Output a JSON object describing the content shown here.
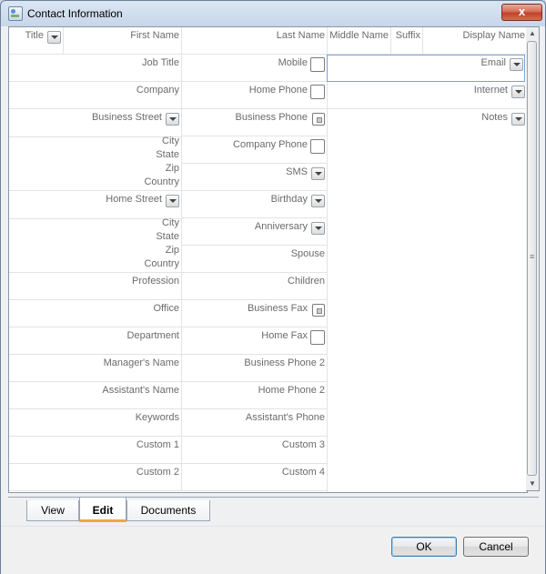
{
  "window": {
    "title": "Contact Information",
    "close_label": "x"
  },
  "header": {
    "title": "Title",
    "first_name": "First Name",
    "last_name": "Last Name",
    "middle_name": "Middle Name",
    "suffix": "Suffix",
    "display_name": "Display Name"
  },
  "col1": {
    "job_title": "Job Title",
    "company": "Company",
    "business_street": "Business Street",
    "business_city": "City",
    "business_state": "State",
    "business_zip": "Zip",
    "business_country": "Country",
    "home_street": "Home Street",
    "home_city": "City",
    "home_state": "State",
    "home_zip": "Zip",
    "home_country": "Country",
    "profession": "Profession",
    "office": "Office",
    "department": "Department",
    "managers_name": "Manager's Name",
    "assistants_name": "Assistant's Name",
    "keywords": "Keywords",
    "custom1": "Custom 1",
    "custom2": "Custom 2"
  },
  "col2": {
    "mobile": "Mobile",
    "home_phone": "Home Phone",
    "business_phone": "Business Phone",
    "company_phone": "Company Phone",
    "sms": "SMS",
    "birthday": "Birthday",
    "anniversary": "Anniversary",
    "spouse": "Spouse",
    "children": "Children",
    "business_fax": "Business Fax",
    "home_fax": "Home Fax",
    "business_phone2": "Business Phone 2",
    "home_phone2": "Home Phone 2",
    "assistants_phone": "Assistant's Phone",
    "custom3": "Custom 3",
    "custom4": "Custom 4"
  },
  "col3": {
    "email": "Email",
    "internet": "Internet",
    "notes": "Notes"
  },
  "tabs": [
    {
      "label": "View",
      "active": false
    },
    {
      "label": "Edit",
      "active": true
    },
    {
      "label": "Documents",
      "active": false
    }
  ],
  "buttons": {
    "ok": "OK",
    "cancel": "Cancel"
  },
  "colors": {
    "accent_tab": "#f3a63c",
    "close_button": "#c0412a",
    "focus_border": "#7da2ce"
  }
}
